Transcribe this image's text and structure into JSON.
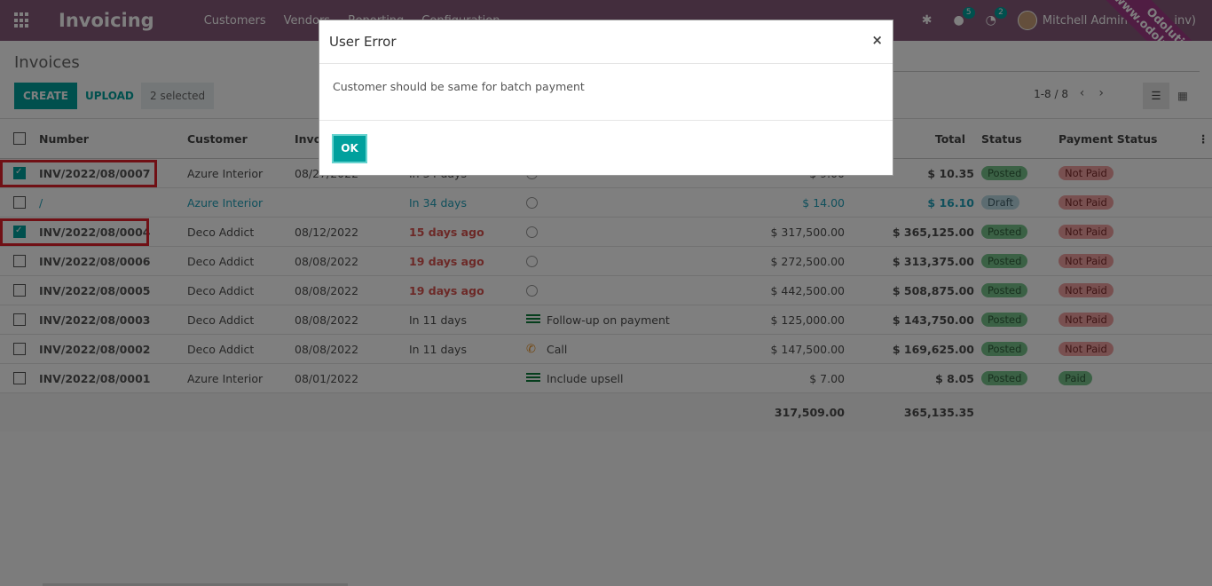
{
  "navbar": {
    "brand": "Invoicing",
    "menu": [
      "Customers",
      "Vendors",
      "Reporting",
      "Configuration"
    ],
    "chat_badge": "5",
    "activity_badge": "2",
    "user": "Mitchell Admin (batch_inv)",
    "watermark_line1": "Odolution",
    "watermark_line2": "(www.odolution.com)"
  },
  "control": {
    "title": "Invoices",
    "create": "CREATE",
    "upload": "UPLOAD",
    "selected": "2 selected",
    "pager": "1-8 / 8"
  },
  "table": {
    "headers": {
      "number": "Number",
      "customer": "Customer",
      "invoice_date": "Invoice Date",
      "total": "Total",
      "status": "Status",
      "payment_status": "Payment Status"
    },
    "rows": [
      {
        "number": "INV/2022/08/0007",
        "customer": "Azure Interior",
        "date": "08/27/2022",
        "due": "In 34 days",
        "due_kind": "normal",
        "activity": "",
        "activity_kind": "clock",
        "untaxed": "$ 9.00",
        "total": "$ 10.35",
        "status": "Posted",
        "payment": "Not Paid",
        "checked": true,
        "draft": false
      },
      {
        "number": "/",
        "customer": "Azure Interior",
        "date": "",
        "due": "In 34 days",
        "due_kind": "draft",
        "activity": "",
        "activity_kind": "clock",
        "untaxed": "$ 14.00",
        "total": "$ 16.10",
        "status": "Draft",
        "payment": "Not Paid",
        "checked": false,
        "draft": true
      },
      {
        "number": "INV/2022/08/0004",
        "customer": "Deco Addict",
        "date": "08/12/2022",
        "due": "15 days ago",
        "due_kind": "overdue",
        "activity": "",
        "activity_kind": "clock",
        "untaxed": "$ 317,500.00",
        "total": "$ 365,125.00",
        "status": "Posted",
        "payment": "Not Paid",
        "checked": true,
        "draft": false
      },
      {
        "number": "INV/2022/08/0006",
        "customer": "Deco Addict",
        "date": "08/08/2022",
        "due": "19 days ago",
        "due_kind": "overdue",
        "activity": "",
        "activity_kind": "clock",
        "untaxed": "$ 272,500.00",
        "total": "$ 313,375.00",
        "status": "Posted",
        "payment": "Not Paid",
        "checked": false,
        "draft": false
      },
      {
        "number": "INV/2022/08/0005",
        "customer": "Deco Addict",
        "date": "08/08/2022",
        "due": "19 days ago",
        "due_kind": "overdue",
        "activity": "",
        "activity_kind": "clock",
        "untaxed": "$ 442,500.00",
        "total": "$ 508,875.00",
        "status": "Posted",
        "payment": "Not Paid",
        "checked": false,
        "draft": false
      },
      {
        "number": "INV/2022/08/0003",
        "customer": "Deco Addict",
        "date": "08/08/2022",
        "due": "In 11 days",
        "due_kind": "normal",
        "activity": "Follow-up on payment",
        "activity_kind": "list",
        "untaxed": "$ 125,000.00",
        "total": "$ 143,750.00",
        "status": "Posted",
        "payment": "Not Paid",
        "checked": false,
        "draft": false
      },
      {
        "number": "INV/2022/08/0002",
        "customer": "Deco Addict",
        "date": "08/08/2022",
        "due": "In 11 days",
        "due_kind": "normal",
        "activity": "Call",
        "activity_kind": "phone",
        "untaxed": "$ 147,500.00",
        "total": "$ 169,625.00",
        "status": "Posted",
        "payment": "Not Paid",
        "checked": false,
        "draft": false
      },
      {
        "number": "INV/2022/08/0001",
        "customer": "Azure Interior",
        "date": "08/01/2022",
        "due": "",
        "due_kind": "normal",
        "activity": "Include upsell",
        "activity_kind": "list",
        "untaxed": "$ 7.00",
        "total": "$ 8.05",
        "status": "Posted",
        "payment": "Paid",
        "checked": false,
        "draft": false
      }
    ],
    "footer": {
      "untaxed_sum": "317,509.00",
      "total_sum": "365,135.35"
    }
  },
  "modal": {
    "title": "User Error",
    "message": "Customer should be same for batch payment",
    "ok": "OK"
  }
}
